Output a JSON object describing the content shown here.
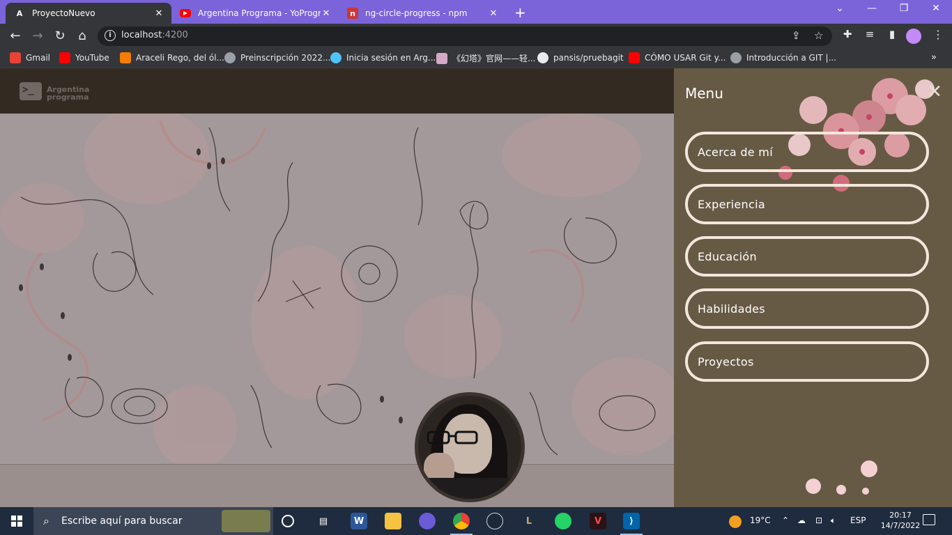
{
  "browser": {
    "tabs": [
      {
        "title": "ProyectoNuevo",
        "favicon": "angular-icon",
        "active": true
      },
      {
        "title": "Argentina Programa - YoProgramo",
        "favicon": "youtube-icon",
        "active": false
      },
      {
        "title": "ng-circle-progress - npm",
        "favicon": "npm-icon",
        "active": false
      }
    ],
    "address": {
      "host": "localhost",
      "port": ":4200"
    },
    "bookmarks": [
      {
        "label": "Gmail",
        "color": "#ea4335"
      },
      {
        "label": "YouTube",
        "color": "#ff0000"
      },
      {
        "label": "Araceli Rego, del ól...",
        "color": "#f57d00"
      },
      {
        "label": "Preinscripción 2022...",
        "color": "#9aa0a6"
      },
      {
        "label": "Inicia sesión en Arg...",
        "color": "#4fc3f7"
      },
      {
        "label": "《幻塔》官网——轻...",
        "color": "#d7a9c9"
      },
      {
        "label": "pansis/pruebagit",
        "color": "#e8eaed"
      },
      {
        "label": "CÓMO USAR Git y...",
        "color": "#ff0000"
      },
      {
        "label": "Introducción a GIT |...",
        "color": "#9aa0a6"
      }
    ]
  },
  "site": {
    "logo_line1": "Argentina",
    "logo_line2": "programa",
    "logo_glyph": ">_"
  },
  "menu": {
    "title": "Menu",
    "close_glyph": "✕",
    "items": [
      {
        "label": "Acerca de mí"
      },
      {
        "label": "Experiencia"
      },
      {
        "label": "Educación"
      },
      {
        "label": "Habilidades"
      },
      {
        "label": "Proyectos"
      }
    ]
  },
  "taskbar": {
    "search_placeholder": "Escribe aquí para buscar",
    "weather": "19°C",
    "language": "ESP",
    "time": "20:17",
    "date": "14/7/2022"
  }
}
